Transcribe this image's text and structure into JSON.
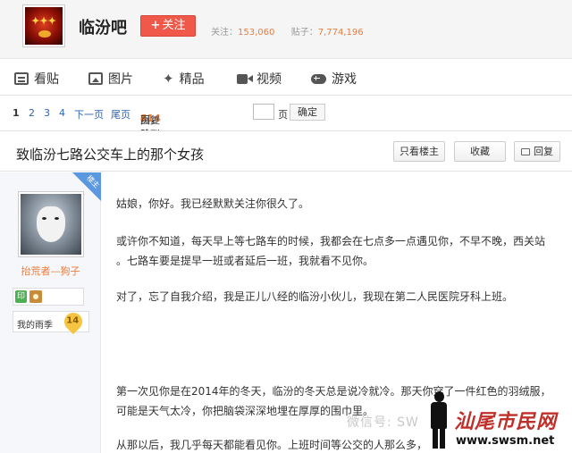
{
  "forum": {
    "name": "临汾吧",
    "follow_label": "关注",
    "follow_plus": "+",
    "stats_follow_label": "关注：",
    "stats_follow_value": "153,060",
    "stats_posts_label": "贴子：",
    "stats_posts_value": "7,774,196"
  },
  "nav": {
    "items": [
      {
        "label": "看贴",
        "icon": "document-icon"
      },
      {
        "label": "图片",
        "icon": "picture-icon"
      },
      {
        "label": "精品",
        "icon": "star-icon"
      },
      {
        "label": "视频",
        "icon": "video-icon"
      },
      {
        "label": "游戏",
        "icon": "gamepad-icon"
      }
    ]
  },
  "pager": {
    "current": "1",
    "pages": [
      "2",
      "3",
      "4"
    ],
    "next": "下一页",
    "last": "尾页",
    "reply_count": "114",
    "reply_text": "回复贴，共",
    "page_total": "4",
    "page_text": "页，跳到",
    "page_suffix": "页",
    "confirm": "确定"
  },
  "thread": {
    "title": "致临汾七路公交车上的那个女孩",
    "btn_only_lz": "只看楼主",
    "btn_collect": "收藏",
    "btn_reply": "回复"
  },
  "author": {
    "badge": "楼主",
    "username": "抬荒者—狗子",
    "level_name": "我的雨季",
    "level": "14",
    "icon_label": "印"
  },
  "post": {
    "paragraphs": [
      "姑娘，你好。我已经默默关注你很久了。",
      "或许你不知道，每天早上等七路车的时候，我都会在七点多一点遇见你，不早不晚，西关站",
      "。七路车要是提早一班或者延后一班，我就看不见你。",
      "对了，忘了自我介绍，我是正儿八经的临汾小伙儿，我现在第二人民医院牙科上班。",
      "第一次见你是在2014年的冬天，临汾的冬天总是说冷就冷。那天你穿了一件红色的羽绒服，",
      "可能是天气太冷，你把脑袋深深地埋在厚厚的围巾里。",
      "从那以后，我几乎每天都能看见你。上班时间等公交的人那么多，"
    ]
  },
  "watermark": {
    "wechat": "微信号: SW",
    "brand": "汕尾市民网",
    "url": "www.swsm.net"
  },
  "colors": {
    "accent_red": "#f0584a",
    "link_blue": "#2d64b3",
    "orange": "#e87d3e"
  }
}
